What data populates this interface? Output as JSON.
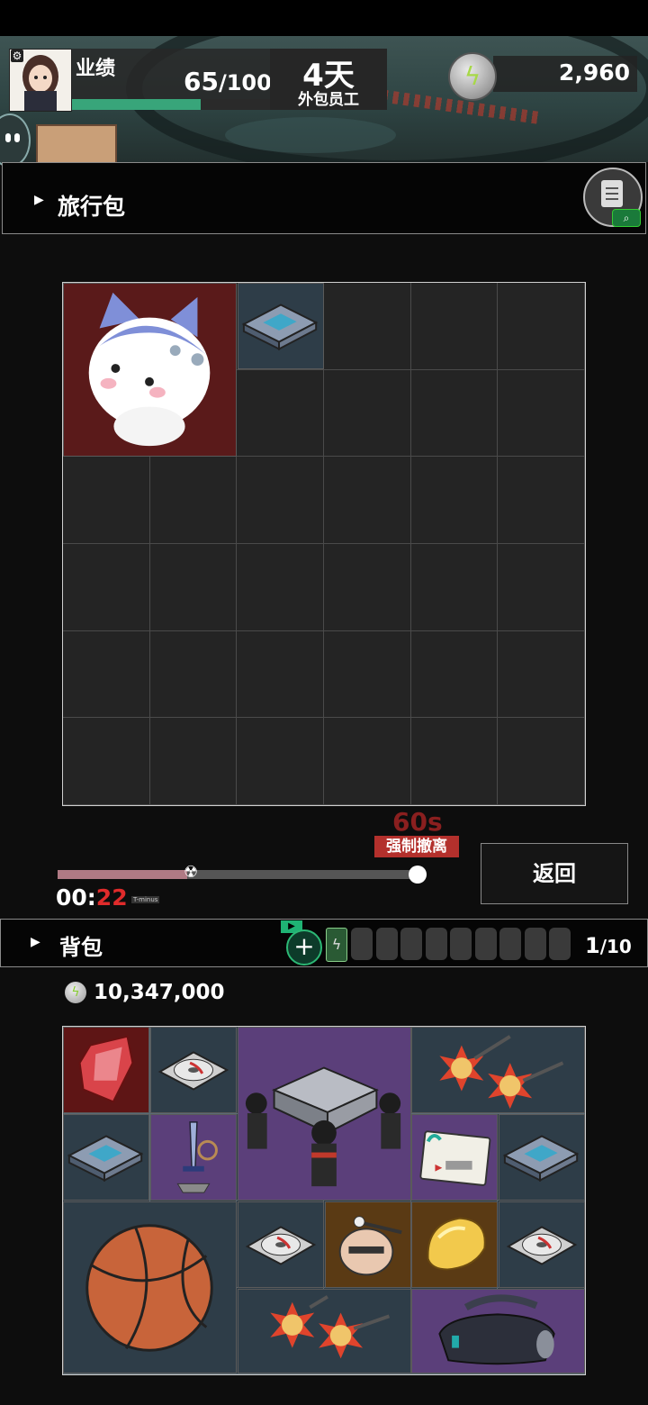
{
  "header": {
    "performance_label": "业绩",
    "performance_value": "65",
    "performance_max": "/100",
    "performance_fraction": 0.65,
    "day_value": "4天",
    "day_subtitle": "外包员工",
    "currency_value": "2,960"
  },
  "travel_bag": {
    "title": "旅行包",
    "grid": {
      "columns": 6,
      "rows": 6
    },
    "items": [
      {
        "name": "cat-mascot-item",
        "icon": "cat-icon",
        "color": "#5a1a1a"
      },
      {
        "name": "hard-drive-item",
        "icon": "hard-drive-icon",
        "color": "#2e3d48"
      }
    ]
  },
  "evacuation": {
    "countdown": "60s",
    "label": "强制撤离",
    "timer_prefix": "00:",
    "timer_seconds": "22",
    "tminus_label": "T-minus",
    "progress_fraction": 0.36,
    "return_label": "返回"
  },
  "backpack": {
    "title": "背包",
    "count": "1",
    "count_max": "/10",
    "empty_slots": 9,
    "money": "10,347,000",
    "grid": {
      "columns": 6,
      "rows": 4
    },
    "items": [
      {
        "name": "crystal-item",
        "icon": "crystal-icon",
        "color": "#5e1515"
      },
      {
        "name": "disc-item",
        "icon": "disc-icon",
        "color": "#2e3d48"
      },
      {
        "name": "coffin-dance-speaker-item",
        "icon": "speaker-icon",
        "color": "#5b3f7a"
      },
      {
        "name": "spiked-flail-item",
        "icon": "flail-icon",
        "color": "#2e3d48"
      },
      {
        "name": "hard-drive-item",
        "icon": "hard-drive-icon",
        "color": "#2e3d48"
      },
      {
        "name": "sword-statue-item",
        "icon": "sword-icon",
        "color": "#5b3f7a"
      },
      {
        "name": "card-item",
        "icon": "card-icon",
        "color": "#5b3f7a"
      },
      {
        "name": "hard-drive-item",
        "icon": "hard-drive-icon",
        "color": "#2e3d48"
      },
      {
        "name": "basketball-item",
        "icon": "basketball-icon",
        "color": "#2e3d48"
      },
      {
        "name": "disc-item",
        "icon": "disc-icon",
        "color": "#2e3d48"
      },
      {
        "name": "robot-head-item",
        "icon": "robot-head-icon",
        "color": "#5a3a14"
      },
      {
        "name": "golden-blob-item",
        "icon": "gold-icon",
        "color": "#5a3a14"
      },
      {
        "name": "disc-item",
        "icon": "disc-icon",
        "color": "#2e3d48"
      },
      {
        "name": "spiked-flail-item",
        "icon": "flail-icon",
        "color": "#2e3d48"
      },
      {
        "name": "vr-headset-item",
        "icon": "vr-headset-icon",
        "color": "#5b3f7a"
      }
    ]
  }
}
